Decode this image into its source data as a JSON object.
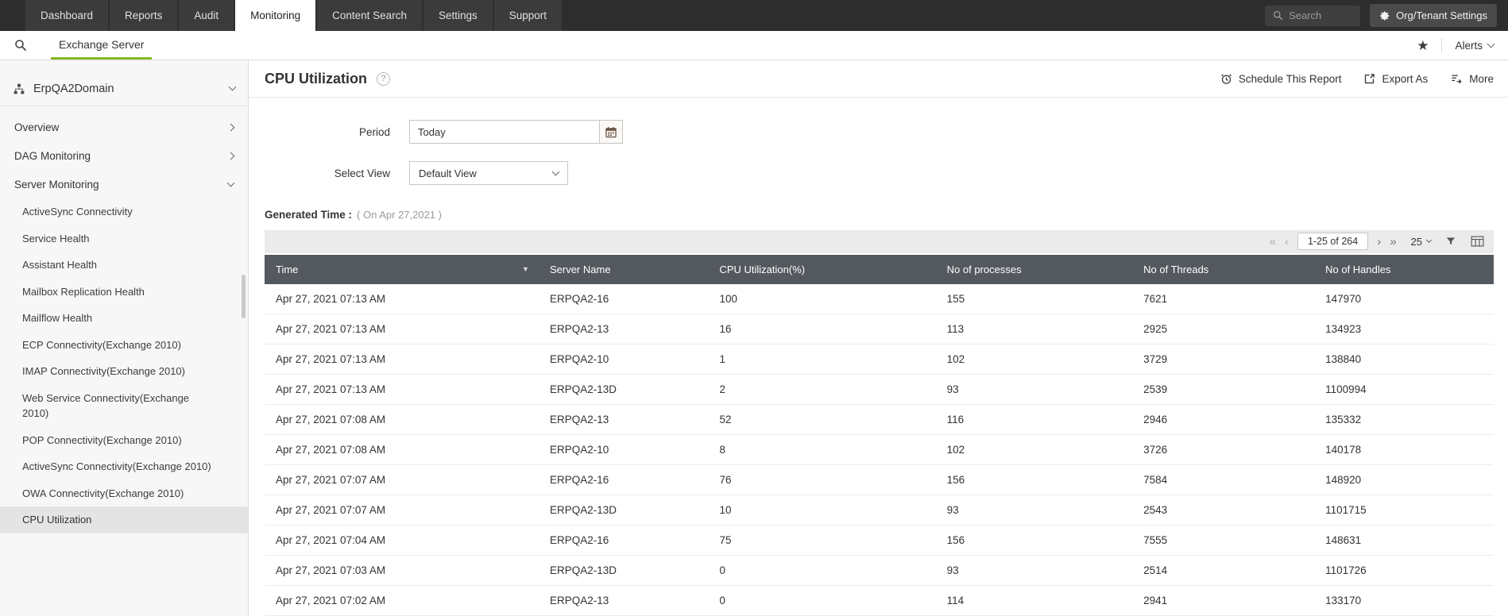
{
  "colors": {
    "accent": "#84bc20",
    "table_header_bg": "#54595f",
    "top_nav_bg": "#2d2d2d"
  },
  "icons": {
    "star": "★",
    "help": "?",
    "first": "«",
    "prev": "‹",
    "next": "›",
    "last": "»",
    "sort_desc": "▼"
  },
  "top_nav": {
    "tabs": [
      {
        "label": "Dashboard",
        "active": false
      },
      {
        "label": "Reports",
        "active": false
      },
      {
        "label": "Audit",
        "active": false
      },
      {
        "label": "Monitoring",
        "active": true
      },
      {
        "label": "Content Search",
        "active": false
      },
      {
        "label": "Settings",
        "active": false
      },
      {
        "label": "Support",
        "active": false
      }
    ],
    "search": {
      "placeholder": "Search"
    },
    "org_settings": {
      "label": "Org/Tenant Settings"
    }
  },
  "sub_nav": {
    "active_tab": "Exchange Server",
    "alerts": {
      "label": "Alerts"
    }
  },
  "sidebar": {
    "domain": {
      "label": "ErpQA2Domain"
    },
    "sections": [
      {
        "label": "Overview",
        "state": "collapsed"
      },
      {
        "label": "DAG Monitoring",
        "state": "collapsed"
      },
      {
        "label": "Server Monitoring",
        "state": "expanded"
      }
    ],
    "items": [
      "ActiveSync Connectivity",
      "Service Health",
      "Assistant Health",
      "Mailbox Replication Health",
      "Mailflow Health",
      "ECP Connectivity(Exchange 2010)",
      "IMAP Connectivity(Exchange 2010)",
      "Web Service Connectivity(Exchange 2010)",
      "POP Connectivity(Exchange 2010)",
      "ActiveSync Connectivity(Exchange 2010)",
      "OWA Connectivity(Exchange 2010)",
      "CPU Utilization"
    ],
    "selected_item": "CPU Utilization"
  },
  "main": {
    "title": "CPU Utilization",
    "actions": {
      "schedule": "Schedule This Report",
      "export": "Export As",
      "more": "More"
    },
    "filters": {
      "period": {
        "label": "Period",
        "value": "Today"
      },
      "view": {
        "label": "Select View",
        "value": "Default View"
      }
    },
    "generated": {
      "label": "Generated Time :",
      "value": "( On Apr 27,2021 )"
    },
    "pagination": {
      "range": "1-25 of 264",
      "page_size": "25"
    },
    "table": {
      "columns": [
        "Time",
        "Server Name",
        "CPU Utilization(%)",
        "No of processes",
        "No of Threads",
        "No of Handles"
      ],
      "sorted_column": "Time",
      "rows": [
        [
          "Apr 27, 2021 07:13 AM",
          "ERPQA2-16",
          "100",
          "155",
          "7621",
          "147970"
        ],
        [
          "Apr 27, 2021 07:13 AM",
          "ERPQA2-13",
          "16",
          "113",
          "2925",
          "134923"
        ],
        [
          "Apr 27, 2021 07:13 AM",
          "ERPQA2-10",
          "1",
          "102",
          "3729",
          "138840"
        ],
        [
          "Apr 27, 2021 07:13 AM",
          "ERPQA2-13D",
          "2",
          "93",
          "2539",
          "1100994"
        ],
        [
          "Apr 27, 2021 07:08 AM",
          "ERPQA2-13",
          "52",
          "116",
          "2946",
          "135332"
        ],
        [
          "Apr 27, 2021 07:08 AM",
          "ERPQA2-10",
          "8",
          "102",
          "3726",
          "140178"
        ],
        [
          "Apr 27, 2021 07:07 AM",
          "ERPQA2-16",
          "76",
          "156",
          "7584",
          "148920"
        ],
        [
          "Apr 27, 2021 07:07 AM",
          "ERPQA2-13D",
          "10",
          "93",
          "2543",
          "1101715"
        ],
        [
          "Apr 27, 2021 07:04 AM",
          "ERPQA2-16",
          "75",
          "156",
          "7555",
          "148631"
        ],
        [
          "Apr 27, 2021 07:03 AM",
          "ERPQA2-13D",
          "0",
          "93",
          "2514",
          "1101726"
        ],
        [
          "Apr 27, 2021 07:02 AM",
          "ERPQA2-13",
          "0",
          "114",
          "2941",
          "133170"
        ]
      ]
    }
  }
}
